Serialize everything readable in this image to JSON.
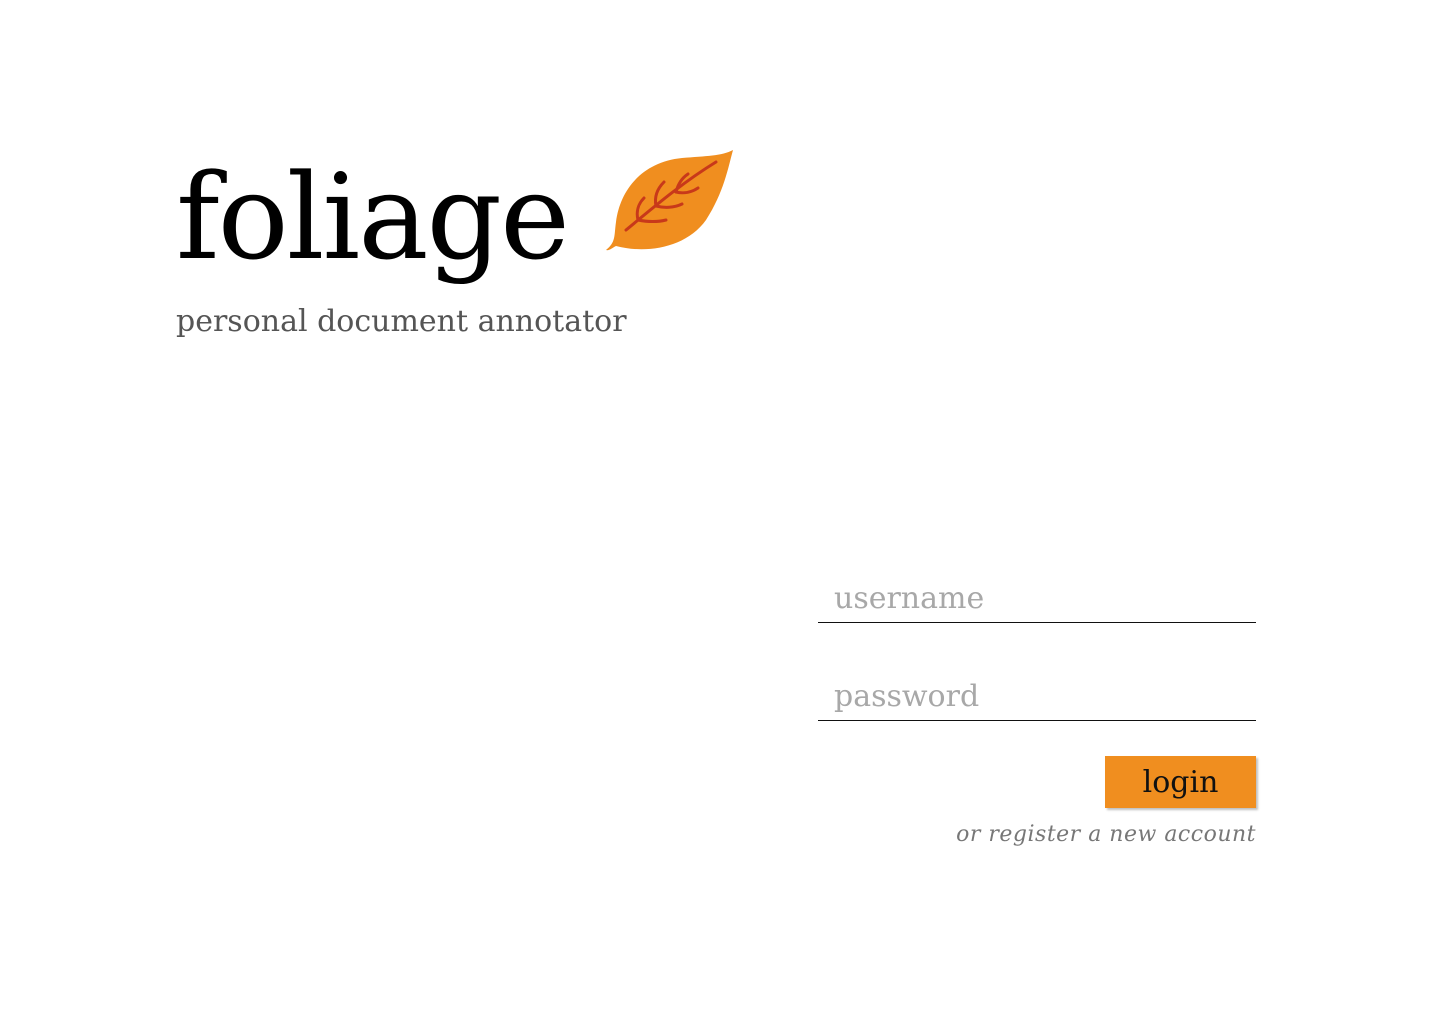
{
  "brand": {
    "title": "foliage",
    "tagline": "personal document annotator",
    "logo_icon": "leaf-icon",
    "leaf_color": "#f08e1f",
    "vein_color": "#c8391a"
  },
  "login": {
    "username_placeholder": "username",
    "username_value": "",
    "password_placeholder": "password",
    "password_value": "",
    "login_label": "login",
    "register_text": "or register a new account",
    "button_color": "#f08e1f"
  }
}
